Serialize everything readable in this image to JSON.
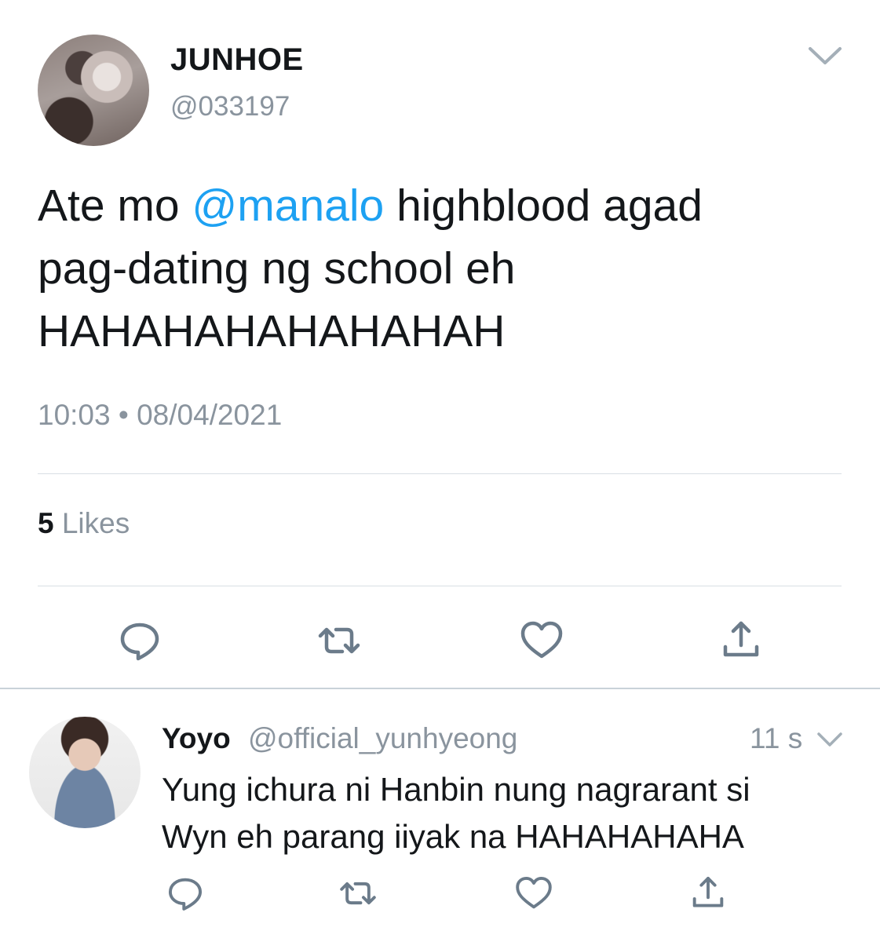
{
  "tweet": {
    "author_name": "JUNHOE",
    "author_handle": "@033197",
    "text_before": "Ate mo ",
    "mention": "@manalo",
    "text_after": " highblood agad\npag-dating ng school eh\nHAHAHAHAHAHAHAH",
    "time": "10:03",
    "separator": " • ",
    "date": "08/04/2021",
    "likes_count": "5",
    "likes_label": " Likes",
    "icons": [
      "chevron-down-icon",
      "reply-icon",
      "retweet-icon",
      "like-icon",
      "share-icon"
    ]
  },
  "reply": {
    "author_name": "Yoyo",
    "author_handle": "@official_yunhyeong",
    "time_ago": "11 s",
    "text": "Yung ichura ni Hanbin nung nagrarant si\nWyn eh parang iiyak na HAHAHAHAHA",
    "icons": [
      "chevron-down-icon",
      "reply-icon",
      "retweet-icon",
      "like-icon",
      "share-icon"
    ]
  },
  "colors": {
    "mention": "#1da1f2",
    "secondary_text": "#8a949e",
    "icon": "#6b7b8a"
  }
}
